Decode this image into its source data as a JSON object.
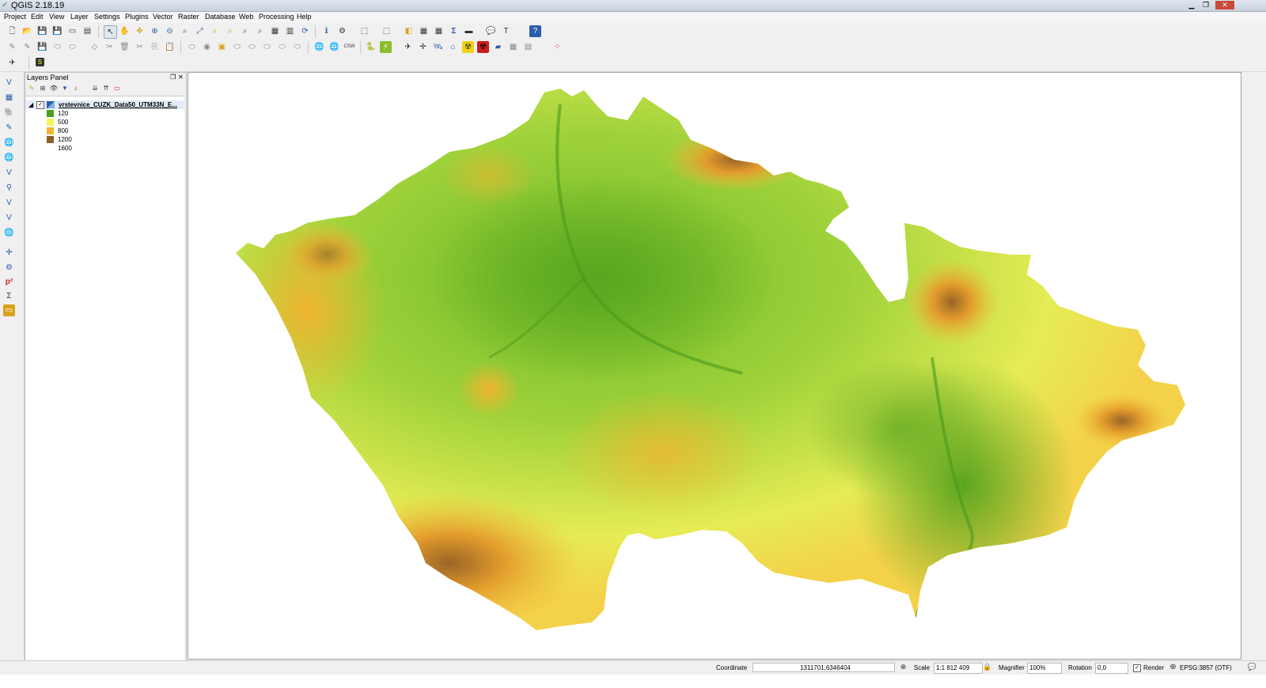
{
  "window": {
    "title": "QGIS 2.18.19"
  },
  "menu": [
    "Project",
    "Edit",
    "View",
    "Layer",
    "Settings",
    "Plugins",
    "Vector",
    "Raster",
    "Database",
    "Web",
    "Processing",
    "Help"
  ],
  "layers_panel": {
    "title": "Layers Panel",
    "layer_name": "vrstevnice_CUZK_Data50_UTM33N_E...",
    "legend": [
      {
        "label": "120",
        "color": "#4f9c1c"
      },
      {
        "label": "500",
        "color": "#f5f55a"
      },
      {
        "label": "800",
        "color": "#f2b82e"
      },
      {
        "label": "1200",
        "color": "#8e5d28"
      },
      {
        "label": "1600",
        "color": "#ffffff"
      }
    ]
  },
  "status": {
    "coordinate_label": "Coordinate",
    "coordinate_value": "1311701,6346404",
    "scale_label": "Scale",
    "scale_value": "1:1 812 409",
    "magnifier_label": "Magnifier",
    "magnifier_value": "100%",
    "rotation_label": "Rotation",
    "rotation_value": "0,0",
    "render_label": "Render",
    "crs": "EPSG:3857 (OTF)"
  },
  "colors": {
    "low": "#4f9c1c",
    "mid": "#f5f55a",
    "high": "#f2b82e",
    "peak": "#8e5d28"
  },
  "icons": [
    "new-project-icon",
    "open-project-icon",
    "save-icon",
    "pan-icon",
    "zoom-in-icon",
    "zoom-out-icon",
    "identify-icon",
    "python-icon",
    "help-icon"
  ]
}
